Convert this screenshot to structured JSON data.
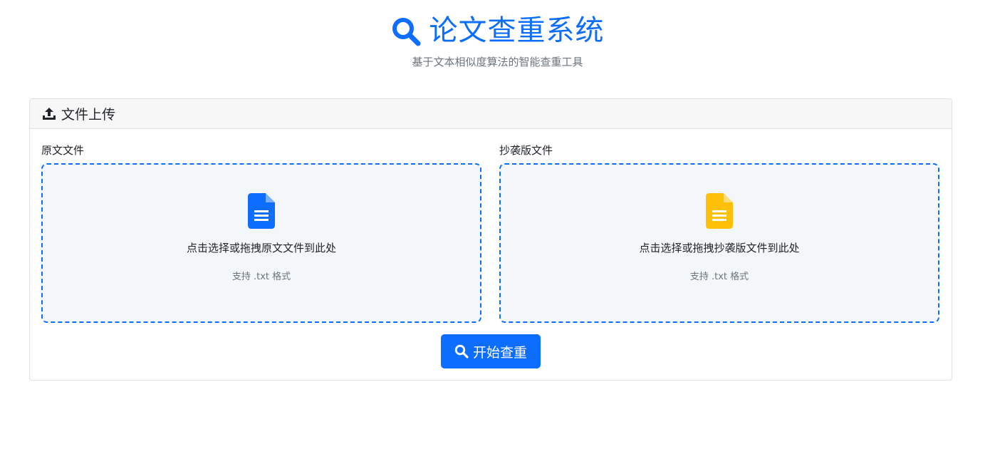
{
  "header": {
    "title": "论文查重系统",
    "subtitle": "基于文本相似度算法的智能查重工具",
    "title_icon": "search-icon"
  },
  "upload_card": {
    "title": "文件上传",
    "title_icon": "upload-icon",
    "original": {
      "label": "原文文件",
      "prompt": "点击选择或拖拽原文文件到此处",
      "hint": "支持 .txt 格式",
      "icon": "file-text-icon",
      "icon_color": "#0d6efd"
    },
    "plagiarized": {
      "label": "抄袭版文件",
      "prompt": "点击选择或拖拽抄袭版文件到此处",
      "hint": "支持 .txt 格式",
      "icon": "file-text-icon",
      "icon_color": "#ffc107"
    },
    "start_button": {
      "label": "开始查重",
      "icon": "search-icon"
    }
  },
  "colors": {
    "primary": "#0d6efd",
    "warning": "#ffc107",
    "muted": "#6c757d"
  }
}
